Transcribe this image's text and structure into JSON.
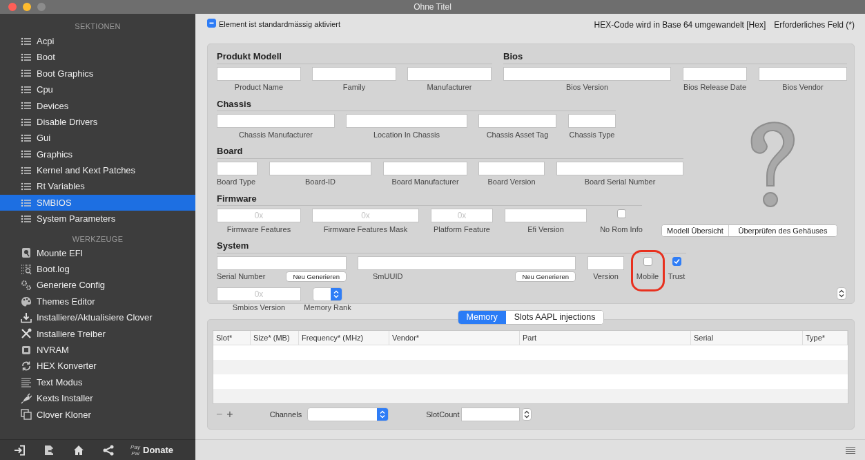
{
  "window": {
    "title": "Ohne Titel"
  },
  "sidebar": {
    "sections_header": "SEKTIONEN",
    "sections": [
      {
        "label": "Acpi",
        "selected": false
      },
      {
        "label": "Boot",
        "selected": false
      },
      {
        "label": "Boot Graphics",
        "selected": false
      },
      {
        "label": "Cpu",
        "selected": false
      },
      {
        "label": "Devices",
        "selected": false
      },
      {
        "label": "Disable Drivers",
        "selected": false
      },
      {
        "label": "Gui",
        "selected": false
      },
      {
        "label": "Graphics",
        "selected": false
      },
      {
        "label": "Kernel and Kext Patches",
        "selected": false
      },
      {
        "label": "Rt Variables",
        "selected": false
      },
      {
        "label": "SMBIOS",
        "selected": true
      },
      {
        "label": "System Parameters",
        "selected": false
      }
    ],
    "tools_header": "WERKZEUGE",
    "tools": [
      {
        "label": "Mounte EFI",
        "selected": false
      },
      {
        "label": "Boot.log",
        "selected": false
      },
      {
        "label": "Generiere Config",
        "selected": false
      },
      {
        "label": "Themes Editor",
        "selected": false
      },
      {
        "label": "Installiere/Aktualisiere Clover",
        "selected": false
      },
      {
        "label": "Installiere Treiber",
        "selected": false
      },
      {
        "label": "NVRAM",
        "selected": false
      },
      {
        "label": "HEX Konverter",
        "selected": false
      },
      {
        "label": "Text Modus",
        "selected": false
      },
      {
        "label": "Kexts Installer",
        "selected": false
      },
      {
        "label": "Clover Kloner",
        "selected": false
      }
    ],
    "footer": {
      "paypal": "Pay Pal",
      "donate": "Donate"
    }
  },
  "top_bar": {
    "default_enabled": {
      "label": "Element ist standardmässig aktiviert",
      "mixed": true
    },
    "hints": [
      "HEX-Code wird in Base 64 umgewandelt [Hex]",
      "Erforderliches Feld (*)"
    ]
  },
  "form": {
    "sections": [
      {
        "title": "Produkt Modell",
        "fields": [
          {
            "kind": "text",
            "label": "Product Name"
          },
          {
            "kind": "text",
            "label": "Family"
          },
          {
            "kind": "text",
            "label": "Manufacturer"
          }
        ]
      },
      {
        "title": "Bios",
        "fields": [
          {
            "kind": "text",
            "label": "Bios Version"
          },
          {
            "kind": "text",
            "label": "Bios Release Date"
          },
          {
            "kind": "text",
            "label": "Bios Vendor"
          }
        ]
      },
      {
        "title": "Chassis",
        "fields": [
          {
            "kind": "text",
            "label": "Chassis Manufacturer"
          },
          {
            "kind": "text",
            "label": "Location In Chassis"
          },
          {
            "kind": "text",
            "label": "Chassis  Asset Tag"
          },
          {
            "kind": "text",
            "label": "Chassis Type"
          }
        ]
      },
      {
        "title": "Board",
        "fields": [
          {
            "kind": "text",
            "label": "Board Type"
          },
          {
            "kind": "text",
            "label": "Board-ID"
          },
          {
            "kind": "text",
            "label": "Board Manufacturer"
          },
          {
            "kind": "text",
            "label": "Board Version"
          },
          {
            "kind": "text",
            "label": "Board Serial Number"
          }
        ]
      },
      {
        "title": "Firmware",
        "fields": [
          {
            "kind": "text",
            "label": "Firmware Features",
            "placeholder": "0x"
          },
          {
            "kind": "text",
            "label": "Firmware Features Mask",
            "placeholder": "0x"
          },
          {
            "kind": "text",
            "label": "Platform Feature",
            "placeholder": "0x"
          },
          {
            "kind": "text",
            "label": "Efi Version"
          },
          {
            "kind": "checkbox",
            "label": "No Rom Info",
            "checked": false
          }
        ]
      },
      {
        "title": "System",
        "fields": [
          {
            "kind": "text",
            "label": "Serial Number",
            "button": "Neu Generieren"
          },
          {
            "kind": "text",
            "label": "SmUUID",
            "button": "Neu Generieren"
          },
          {
            "kind": "text",
            "label": "Version"
          },
          {
            "kind": "checkbox",
            "label": "Mobile",
            "checked": false,
            "highlighted": true
          },
          {
            "kind": "checkbox",
            "label": "Trust",
            "checked": true
          },
          {
            "kind": "text",
            "label": "Smbios Version",
            "placeholder": "0x"
          },
          {
            "kind": "popup",
            "label": "Memory Rank"
          }
        ]
      }
    ],
    "model_buttons": [
      "Modell Übersicht",
      "Überprüfen des Gehäuses"
    ]
  },
  "memory": {
    "tabs": [
      {
        "label": "Memory",
        "selected": true
      },
      {
        "label": "Slots AAPL injections",
        "selected": false
      }
    ],
    "table": {
      "columns": [
        "Slot*",
        "Size* (MB)",
        "Frequency* (MHz)",
        "Vendor*",
        "Part",
        "Serial",
        "Type*"
      ]
    },
    "footer": {
      "remove": {
        "label": "−",
        "disabled": true
      },
      "add": {
        "label": "+",
        "disabled": false
      },
      "channels_label": "Channels",
      "slotcount_label": "SlotCount"
    }
  }
}
